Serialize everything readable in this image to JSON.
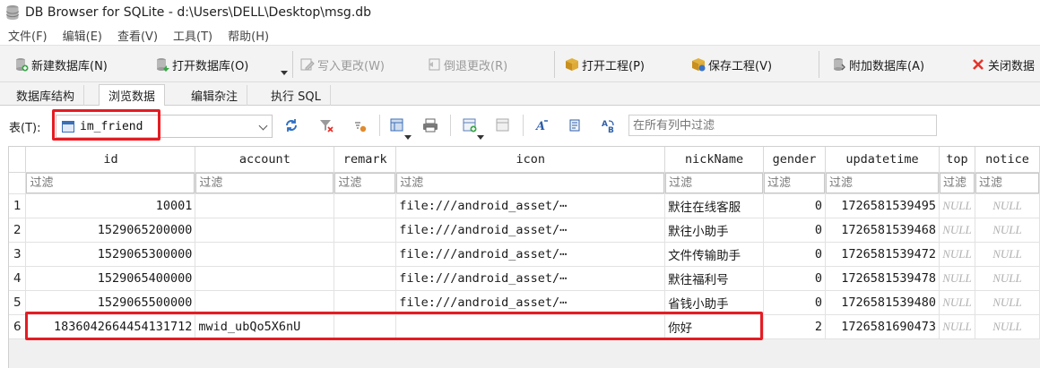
{
  "window": {
    "title": "DB Browser for SQLite - d:\\Users\\DELL\\Desktop\\msg.db"
  },
  "menu": [
    "文件(F)",
    "编辑(E)",
    "查看(V)",
    "工具(T)",
    "帮助(H)"
  ],
  "toolbar": {
    "new_db": "新建数据库(N)",
    "open_db": "打开数据库(O)",
    "write_changes": "写入更改(W)",
    "revert_changes": "倒退更改(R)",
    "open_project": "打开工程(P)",
    "save_project": "保存工程(V)",
    "attach_db": "附加数据库(A)",
    "close_db": "关闭数据"
  },
  "tabs": [
    "数据库结构",
    "浏览数据",
    "编辑杂注",
    "执行 SQL"
  ],
  "active_tab": "浏览数据",
  "browse": {
    "table_label": "表(T):",
    "table_name": "im_friend",
    "global_filter_placeholder": "在所有列中过滤"
  },
  "grid": {
    "columns": [
      "id",
      "account",
      "remark",
      "icon",
      "nickName",
      "gender",
      "updatetime",
      "top",
      "notice"
    ],
    "filter_placeholder": "过滤",
    "rows": [
      {
        "n": "1",
        "cells": [
          "10001",
          "",
          "",
          "file:///android_asset/⋯",
          "默往在线客服",
          "0",
          "1726581539495",
          "NULL",
          "NULL"
        ]
      },
      {
        "n": "2",
        "cells": [
          "1529065200000",
          "",
          "",
          "file:///android_asset/⋯",
          "默往小助手",
          "0",
          "1726581539468",
          "NULL",
          "NULL"
        ]
      },
      {
        "n": "3",
        "cells": [
          "1529065300000",
          "",
          "",
          "file:///android_asset/⋯",
          "文件传输助手",
          "0",
          "1726581539472",
          "NULL",
          "NULL"
        ]
      },
      {
        "n": "4",
        "cells": [
          "1529065400000",
          "",
          "",
          "file:///android_asset/⋯",
          "默往福利号",
          "0",
          "1726581539478",
          "NULL",
          "NULL"
        ]
      },
      {
        "n": "5",
        "cells": [
          "1529065500000",
          "",
          "",
          "file:///android_asset/⋯",
          "省钱小助手",
          "0",
          "1726581539480",
          "NULL",
          "NULL"
        ]
      },
      {
        "n": "6",
        "cells": [
          "1836042664454131712",
          "mwid_ubQo5X6nU",
          "",
          "",
          "你好",
          "2",
          "1726581690473",
          "NULL",
          "NULL"
        ]
      }
    ]
  },
  "colors": {
    "highlight": "#e51c23",
    "null_text": "#b0b0b0"
  }
}
